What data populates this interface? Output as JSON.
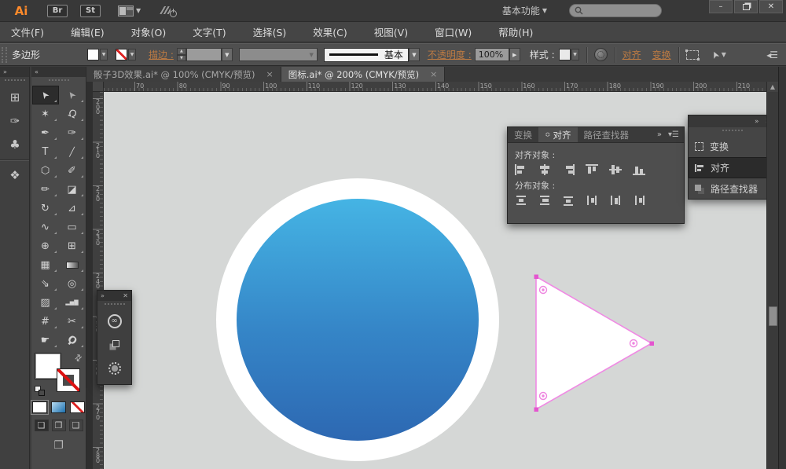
{
  "colors": {
    "logo_orange": "#ff8a2b",
    "link_orange": "#bd7b43",
    "selection_pink": "#f08ae4",
    "anchor_pink": "#e455cf",
    "circle_top": "#45b4e4",
    "circle_bottom": "#2d68b2",
    "canvas_bg": "#d5d7d6"
  },
  "titlebar": {
    "logo": "Ai",
    "bridge": "Br",
    "stock": "St",
    "workspace": "基本功能",
    "window": {
      "minimize": "–",
      "close": "✕"
    }
  },
  "menubar": {
    "items": [
      "文件(F)",
      "编辑(E)",
      "对象(O)",
      "文字(T)",
      "选择(S)",
      "效果(C)",
      "视图(V)",
      "窗口(W)",
      "帮助(H)"
    ]
  },
  "control_bar": {
    "context_label": "多边形",
    "stroke_label": "描边 :",
    "brush_value": "基本",
    "opacity_label": "不透明度 :",
    "opacity_value": "100%",
    "style_label": "样式 :",
    "align_link": "对齐",
    "transform_link": "变换"
  },
  "document_tabs": [
    {
      "title": "骰子3D效果.ai* @ 100% (CMYK/预览)",
      "close": "×",
      "active": false
    },
    {
      "title": "图标.ai* @ 200% (CMYK/预览)",
      "close": "×",
      "active": true
    }
  ],
  "rulers": {
    "horizontal": [
      "70",
      "80",
      "90",
      "100",
      "110",
      "120",
      "130",
      "140",
      "150",
      "160",
      "170",
      "180",
      "190",
      "200",
      "210"
    ],
    "vertical": [
      "200",
      "210",
      "220",
      "230",
      "240",
      "250",
      "260",
      "270",
      "280"
    ]
  },
  "left_strip": {
    "groups": [
      [
        {
          "name": "artboards-panel-icon",
          "glyph": "⊞"
        },
        {
          "name": "brushes-panel-icon",
          "glyph": "✑"
        },
        {
          "name": "symbols-panel-icon",
          "glyph": "♣"
        }
      ],
      [
        {
          "name": "layers-panel-icon",
          "glyph": "❖"
        }
      ]
    ]
  },
  "toolbar": {
    "tools": [
      {
        "name": "selection-tool",
        "glyph": "➤",
        "active": true
      },
      {
        "name": "direct-selection-tool",
        "glyph": "➤"
      },
      {
        "name": "magic-wand-tool",
        "glyph": "✶"
      },
      {
        "name": "lasso-tool",
        "glyph": "Ω"
      },
      {
        "name": "pen-tool",
        "glyph": "✒"
      },
      {
        "name": "curvature-tool",
        "glyph": "✑"
      },
      {
        "name": "type-tool",
        "glyph": "T"
      },
      {
        "name": "line-segment-tool",
        "glyph": "╱"
      },
      {
        "name": "shape-tool",
        "glyph": "⬡"
      },
      {
        "name": "paintbrush-tool",
        "glyph": "✐"
      },
      {
        "name": "pencil-tool",
        "glyph": "✏"
      },
      {
        "name": "eraser-tool",
        "glyph": "◪"
      },
      {
        "name": "rotate-tool",
        "glyph": "↻"
      },
      {
        "name": "scale-tool",
        "glyph": "⊿"
      },
      {
        "name": "width-tool",
        "glyph": "∿"
      },
      {
        "name": "free-transform-tool",
        "glyph": "▭"
      },
      {
        "name": "shape-builder-tool",
        "glyph": "⊕"
      },
      {
        "name": "perspective-grid-tool",
        "glyph": "⊞"
      },
      {
        "name": "mesh-tool",
        "glyph": "▦"
      },
      {
        "name": "gradient-tool",
        "glyph": ""
      },
      {
        "name": "eyedropper-tool",
        "glyph": "⇘"
      },
      {
        "name": "blend-tool",
        "glyph": "◎"
      },
      {
        "name": "symbol-sprayer-tool",
        "glyph": "▨"
      },
      {
        "name": "column-graph-tool",
        "glyph": "▂▅▇"
      },
      {
        "name": "artboard-tool",
        "glyph": "#"
      },
      {
        "name": "slice-tool",
        "glyph": "✂"
      },
      {
        "name": "hand-tool",
        "glyph": "☛"
      },
      {
        "name": "zoom-tool",
        "glyph": "Ϙ"
      }
    ]
  },
  "align_panel": {
    "tabs": [
      {
        "label": "变换",
        "active": false
      },
      {
        "label": "对齐",
        "active": true
      },
      {
        "label": "路径查找器",
        "active": false
      }
    ],
    "align_label": "对齐对象 :",
    "distribute_label": "分布对象 :",
    "align_buttons": [
      "align-left",
      "align-h-center",
      "align-right",
      "align-top",
      "align-v-center",
      "align-bottom"
    ],
    "distribute_buttons": [
      "dist-v-top",
      "dist-v-center",
      "dist-v-bottom",
      "dist-h-left",
      "dist-h-center",
      "dist-h-right"
    ]
  },
  "right_dock": {
    "items": [
      {
        "label": "变换",
        "icon": "transform-icon",
        "active": false
      },
      {
        "label": "对齐",
        "icon": "align-icon",
        "active": true
      },
      {
        "label": "路径查找器",
        "icon": "pathfinder-icon",
        "active": false
      }
    ]
  }
}
